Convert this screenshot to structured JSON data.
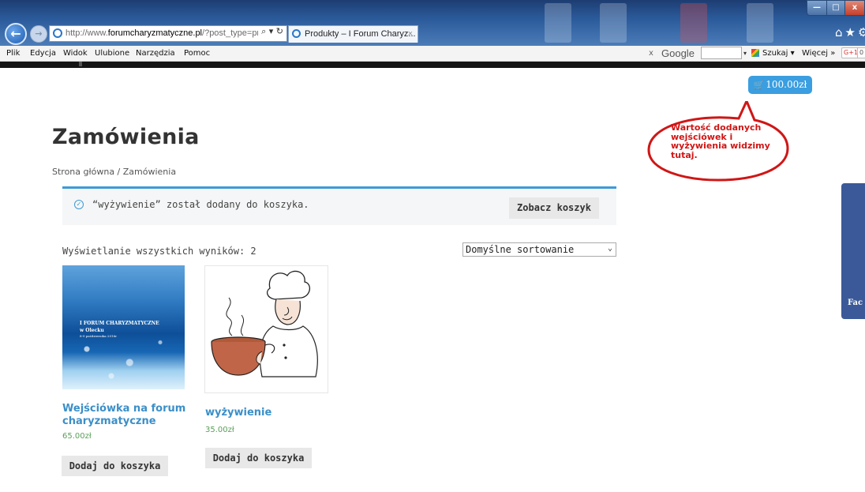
{
  "browser": {
    "address_prefix": "http://www.",
    "address_domain": "forumcharyzmatyczne.pl",
    "address_suffix": "/?post_type=proc",
    "address_tools": "⌕ ▾ ↻",
    "tab_title": "Produkty – I Forum Charyz...",
    "tab_close": "×",
    "window_controls": {
      "minimize": "—",
      "maximize": "□",
      "close": "x"
    },
    "right_icons": "⌂★⚙"
  },
  "menu": {
    "items": [
      "Plik",
      "Edycja",
      "Widok",
      "Ulubione",
      "Narzędzia",
      "Pomoc"
    ]
  },
  "google_toolbar": {
    "close": "x",
    "logo": "Google",
    "dropdown": "▾",
    "search_label": "Szukaj ▾",
    "more_label": "Więcej »",
    "plus_label": "G+1",
    "plus_count": "0"
  },
  "cart": {
    "icon": "cart-icon",
    "icon_glyph": "🛒",
    "total": "100.00zł"
  },
  "callout": {
    "text": "Wartość dodanych wejściówek i wyżywienia widzimy tutaj.",
    "color": "#d01616"
  },
  "page": {
    "title": "Zamówienia",
    "breadcrumb": "Strona główna / Zamówienia"
  },
  "notice": {
    "icon": "check-circle-icon",
    "icon_glyph": "✓",
    "text": "“wyżywienie” został dodany do koszyka.",
    "button": "Zobacz koszyk"
  },
  "shop": {
    "result_count": "Wyświetlanie wszystkich wyników: 2",
    "sort_selected": "Domyślne sortowanie",
    "sort_arrow": "⌄"
  },
  "products": [
    {
      "image_text": [
        "I FORUM CHARYZMATYCZNE",
        "w Olecku",
        "8-9 października 2016r"
      ],
      "title": "Wejściówka na forum charyzmatyczne",
      "price": "65.00zł",
      "button": "Dodaj do koszyka"
    },
    {
      "title": "wyżywienie",
      "price": "35.00zł",
      "button": "Dodaj do koszyka"
    }
  ],
  "facebook_tab": "Fac",
  "colors": {
    "accent": "#3f9ad6",
    "link": "#3b8fc8",
    "price": "#5aa05a",
    "cart_badge": "#3a9ee0",
    "facebook": "#3b5998"
  }
}
